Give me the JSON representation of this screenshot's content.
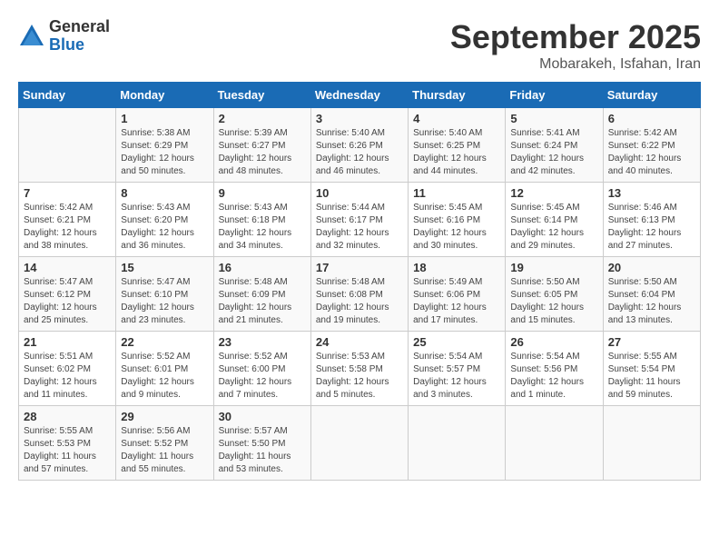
{
  "logo": {
    "general": "General",
    "blue": "Blue"
  },
  "title": "September 2025",
  "location": "Mobarakeh, Isfahan, Iran",
  "headers": [
    "Sunday",
    "Monday",
    "Tuesday",
    "Wednesday",
    "Thursday",
    "Friday",
    "Saturday"
  ],
  "weeks": [
    [
      {
        "day": "",
        "info": ""
      },
      {
        "day": "1",
        "info": "Sunrise: 5:38 AM\nSunset: 6:29 PM\nDaylight: 12 hours\nand 50 minutes."
      },
      {
        "day": "2",
        "info": "Sunrise: 5:39 AM\nSunset: 6:27 PM\nDaylight: 12 hours\nand 48 minutes."
      },
      {
        "day": "3",
        "info": "Sunrise: 5:40 AM\nSunset: 6:26 PM\nDaylight: 12 hours\nand 46 minutes."
      },
      {
        "day": "4",
        "info": "Sunrise: 5:40 AM\nSunset: 6:25 PM\nDaylight: 12 hours\nand 44 minutes."
      },
      {
        "day": "5",
        "info": "Sunrise: 5:41 AM\nSunset: 6:24 PM\nDaylight: 12 hours\nand 42 minutes."
      },
      {
        "day": "6",
        "info": "Sunrise: 5:42 AM\nSunset: 6:22 PM\nDaylight: 12 hours\nand 40 minutes."
      }
    ],
    [
      {
        "day": "7",
        "info": "Sunrise: 5:42 AM\nSunset: 6:21 PM\nDaylight: 12 hours\nand 38 minutes."
      },
      {
        "day": "8",
        "info": "Sunrise: 5:43 AM\nSunset: 6:20 PM\nDaylight: 12 hours\nand 36 minutes."
      },
      {
        "day": "9",
        "info": "Sunrise: 5:43 AM\nSunset: 6:18 PM\nDaylight: 12 hours\nand 34 minutes."
      },
      {
        "day": "10",
        "info": "Sunrise: 5:44 AM\nSunset: 6:17 PM\nDaylight: 12 hours\nand 32 minutes."
      },
      {
        "day": "11",
        "info": "Sunrise: 5:45 AM\nSunset: 6:16 PM\nDaylight: 12 hours\nand 30 minutes."
      },
      {
        "day": "12",
        "info": "Sunrise: 5:45 AM\nSunset: 6:14 PM\nDaylight: 12 hours\nand 29 minutes."
      },
      {
        "day": "13",
        "info": "Sunrise: 5:46 AM\nSunset: 6:13 PM\nDaylight: 12 hours\nand 27 minutes."
      }
    ],
    [
      {
        "day": "14",
        "info": "Sunrise: 5:47 AM\nSunset: 6:12 PM\nDaylight: 12 hours\nand 25 minutes."
      },
      {
        "day": "15",
        "info": "Sunrise: 5:47 AM\nSunset: 6:10 PM\nDaylight: 12 hours\nand 23 minutes."
      },
      {
        "day": "16",
        "info": "Sunrise: 5:48 AM\nSunset: 6:09 PM\nDaylight: 12 hours\nand 21 minutes."
      },
      {
        "day": "17",
        "info": "Sunrise: 5:48 AM\nSunset: 6:08 PM\nDaylight: 12 hours\nand 19 minutes."
      },
      {
        "day": "18",
        "info": "Sunrise: 5:49 AM\nSunset: 6:06 PM\nDaylight: 12 hours\nand 17 minutes."
      },
      {
        "day": "19",
        "info": "Sunrise: 5:50 AM\nSunset: 6:05 PM\nDaylight: 12 hours\nand 15 minutes."
      },
      {
        "day": "20",
        "info": "Sunrise: 5:50 AM\nSunset: 6:04 PM\nDaylight: 12 hours\nand 13 minutes."
      }
    ],
    [
      {
        "day": "21",
        "info": "Sunrise: 5:51 AM\nSunset: 6:02 PM\nDaylight: 12 hours\nand 11 minutes."
      },
      {
        "day": "22",
        "info": "Sunrise: 5:52 AM\nSunset: 6:01 PM\nDaylight: 12 hours\nand 9 minutes."
      },
      {
        "day": "23",
        "info": "Sunrise: 5:52 AM\nSunset: 6:00 PM\nDaylight: 12 hours\nand 7 minutes."
      },
      {
        "day": "24",
        "info": "Sunrise: 5:53 AM\nSunset: 5:58 PM\nDaylight: 12 hours\nand 5 minutes."
      },
      {
        "day": "25",
        "info": "Sunrise: 5:54 AM\nSunset: 5:57 PM\nDaylight: 12 hours\nand 3 minutes."
      },
      {
        "day": "26",
        "info": "Sunrise: 5:54 AM\nSunset: 5:56 PM\nDaylight: 12 hours\nand 1 minute."
      },
      {
        "day": "27",
        "info": "Sunrise: 5:55 AM\nSunset: 5:54 PM\nDaylight: 11 hours\nand 59 minutes."
      }
    ],
    [
      {
        "day": "28",
        "info": "Sunrise: 5:55 AM\nSunset: 5:53 PM\nDaylight: 11 hours\nand 57 minutes."
      },
      {
        "day": "29",
        "info": "Sunrise: 5:56 AM\nSunset: 5:52 PM\nDaylight: 11 hours\nand 55 minutes."
      },
      {
        "day": "30",
        "info": "Sunrise: 5:57 AM\nSunset: 5:50 PM\nDaylight: 11 hours\nand 53 minutes."
      },
      {
        "day": "",
        "info": ""
      },
      {
        "day": "",
        "info": ""
      },
      {
        "day": "",
        "info": ""
      },
      {
        "day": "",
        "info": ""
      }
    ]
  ]
}
